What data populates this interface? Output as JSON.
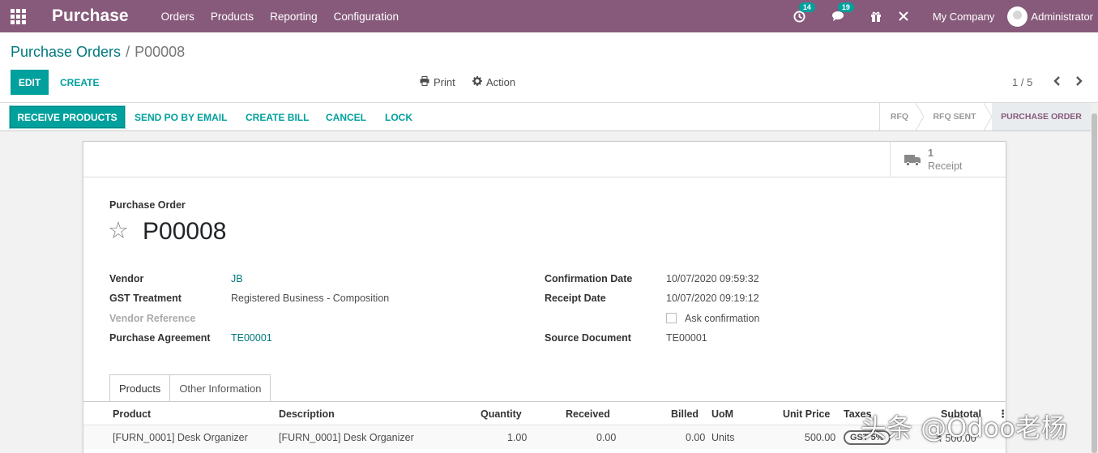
{
  "navbar": {
    "app_title": "Purchase",
    "menu": [
      "Orders",
      "Products",
      "Reporting",
      "Configuration"
    ],
    "activity_count": "14",
    "messages_count": "19",
    "company": "My Company",
    "user": "Administrator"
  },
  "breadcrumb": {
    "parent": "Purchase Orders",
    "separator": "/",
    "current": "P00008"
  },
  "buttons": {
    "edit": "EDIT",
    "create": "CREATE",
    "print": "Print",
    "action": "Action"
  },
  "pager": {
    "value": "1 / 5"
  },
  "statusbar": {
    "actions": [
      "RECEIVE PRODUCTS",
      "SEND PO BY EMAIL",
      "CREATE BILL",
      "CANCEL",
      "LOCK"
    ],
    "stages": [
      "RFQ",
      "RFQ SENT",
      "PURCHASE ORDER"
    ],
    "active_stage": "PURCHASE ORDER"
  },
  "smart_button": {
    "count": "1",
    "label": "Receipt"
  },
  "order": {
    "doc_label": "Purchase Order",
    "name": "P00008"
  },
  "fields": {
    "vendor": {
      "label": "Vendor",
      "value": "JB"
    },
    "gst_treatment": {
      "label": "GST Treatment",
      "value": "Registered Business - Composition"
    },
    "vendor_reference": {
      "label": "Vendor Reference",
      "value": ""
    },
    "purchase_agreement": {
      "label": "Purchase Agreement",
      "value": "TE00001"
    },
    "confirmation_date": {
      "label": "Confirmation Date",
      "value": "10/07/2020 09:59:32"
    },
    "receipt_date": {
      "label": "Receipt Date",
      "value": "10/07/2020 09:19:12"
    },
    "ask_confirmation": {
      "label": "Ask confirmation",
      "checked": false
    },
    "source_document": {
      "label": "Source Document",
      "value": "TE00001"
    }
  },
  "tabs": [
    "Products",
    "Other Information"
  ],
  "lines_table": {
    "headers": [
      "Product",
      "Description",
      "Quantity",
      "Received",
      "Billed",
      "UoM",
      "Unit Price",
      "Taxes",
      "Subtotal"
    ],
    "rows": [
      {
        "product": "[FURN_0001] Desk Organizer",
        "description": "[FURN_0001] Desk Organizer",
        "quantity": "1.00",
        "received": "0.00",
        "billed": "0.00",
        "uom": "Units",
        "unit_price": "500.00",
        "taxes": "GST 5%",
        "subtotal": "₹ 500.00"
      }
    ]
  },
  "watermark": "头条 @Odoo老杨",
  "colors": {
    "navbar": "#875a7b",
    "primary": "#00a09d",
    "link": "#00797c"
  }
}
